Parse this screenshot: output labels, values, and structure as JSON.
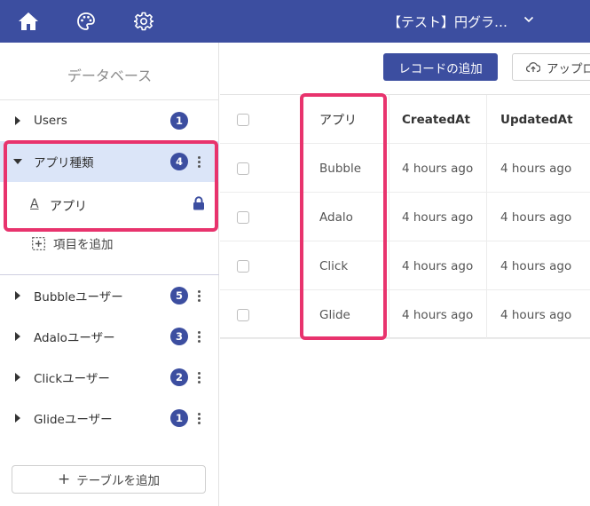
{
  "header": {
    "app_title": "【テスト】円グラ…",
    "icons": [
      "home-icon",
      "palette-icon",
      "gear-icon",
      "chevron-down-icon"
    ],
    "bar_color": "#3c4ea0"
  },
  "sidebar": {
    "title": "データベース",
    "tables": [
      {
        "label": "Users",
        "count": "1",
        "expanded": false
      },
      {
        "label": "アプリ種類",
        "count": "4",
        "expanded": true,
        "selected": true
      },
      {
        "label": "Bubbleユーザー",
        "count": "5",
        "expanded": false
      },
      {
        "label": "Adaloユーザー",
        "count": "3",
        "expanded": false
      },
      {
        "label": "Clickユーザー",
        "count": "2",
        "expanded": false
      },
      {
        "label": "Glideユーザー",
        "count": "1",
        "expanded": false
      }
    ],
    "field": {
      "type_icon": "A",
      "label": "アプリ",
      "locked": true
    },
    "add_field_label": "項目を追加",
    "add_table_plus": "+",
    "add_table_label": "テーブルを追加"
  },
  "toolbar": {
    "add_record_label": "レコードの追加",
    "upload_label": "アップロード"
  },
  "table": {
    "columns": [
      "アプリ",
      "CreatedAt",
      "UpdatedAt"
    ],
    "rows": [
      {
        "app": "Bubble",
        "created": "4 hours ago",
        "updated": "4 hours ago"
      },
      {
        "app": "Adalo",
        "created": "4 hours ago",
        "updated": "4 hours ago"
      },
      {
        "app": "Click",
        "created": "4 hours ago",
        "updated": "4 hours ago"
      },
      {
        "app": "Glide",
        "created": "4 hours ago",
        "updated": "4 hours ago"
      }
    ]
  },
  "colors": {
    "accent": "#3c4ea0",
    "highlight": "#e8336d",
    "selected_row": "#dbe5f8"
  }
}
